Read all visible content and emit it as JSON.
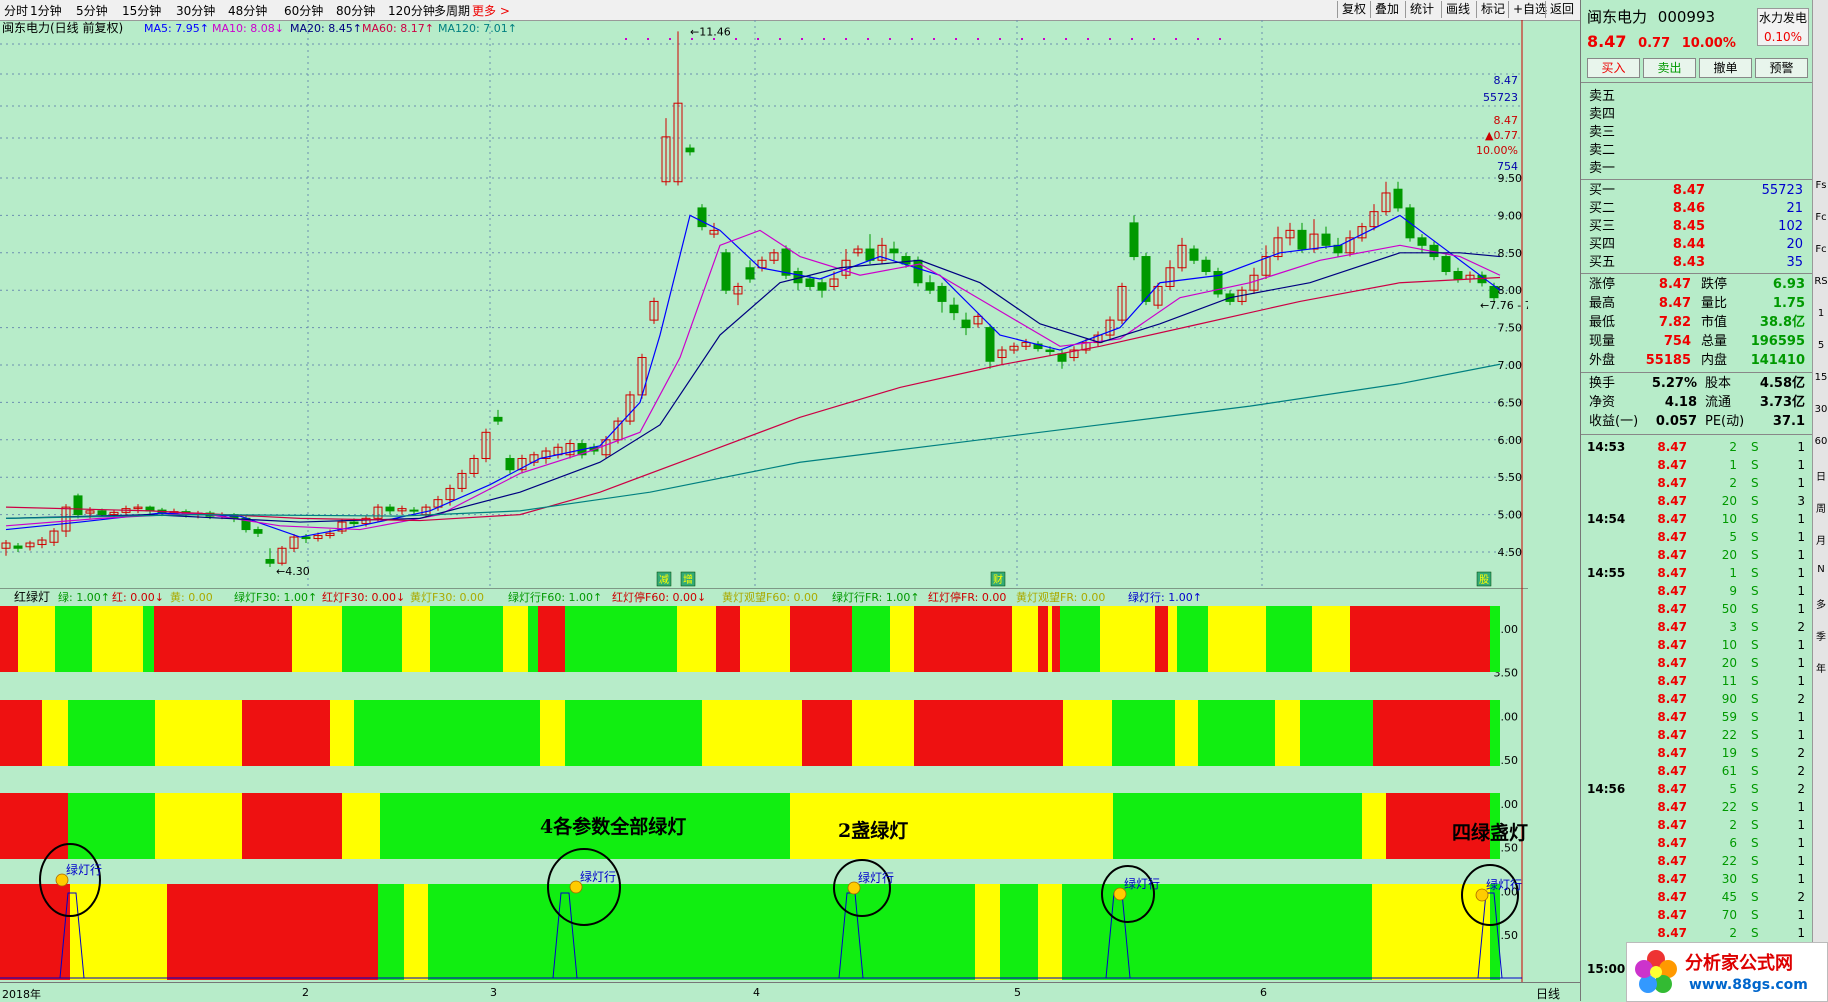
{
  "topbar": {
    "periods": [
      "分时",
      "1分钟",
      "5分钟",
      "15分钟",
      "30分钟",
      "48分钟",
      "60分钟",
      "80分钟",
      "120分钟",
      "多周期",
      "更多 >"
    ],
    "tools": [
      "复权",
      "叠加",
      "统计",
      "画线",
      "标记",
      "+自选",
      "返回"
    ]
  },
  "main": {
    "title": "闽东电力(日线 前复权)",
    "ma_labels": [
      "MA5: 7.95↑",
      "MA10: 8.08↓",
      "MA20: 8.45↑",
      "MA60: 8.17↑",
      "MA120: 7.01↑"
    ],
    "ma_colors": [
      "#0000ff",
      "#cc00cc",
      "#000080",
      "#cc0044",
      "#008080"
    ],
    "high_label": "11.46",
    "low_label": "4.30",
    "range_label": "7.76 - 7.8",
    "price_scale": [
      "9.50",
      "9.00",
      "8.50",
      "8.00",
      "7.50",
      "7.00",
      "6.50",
      "6.00",
      "5.50",
      "5.00",
      "4.50"
    ],
    "side_quote": [
      "8.47",
      "55723",
      "8.47",
      "▲0.77",
      "10.00%",
      "754"
    ],
    "markers": [
      "减",
      "增",
      "财",
      "股"
    ]
  },
  "indicator": {
    "title": "红绿灯",
    "legend": [
      "绿: 1.00↑",
      "红: 0.00↓",
      "黄: 0.00",
      "绿灯F30: 1.00↑",
      "红灯F30: 0.00↓",
      "黄灯F30: 0.00",
      "绿灯行F60: 1.00↑",
      "红灯停F60: 0.00↓",
      "黄灯观望F60: 0.00",
      "绿灯行FR: 1.00↑",
      "红灯停FR: 0.00",
      "黄灯观望FR: 0.00",
      "绿灯行: 1.00↑"
    ],
    "scale": [
      "4.00",
      "3.50",
      "3.00",
      "2.50",
      "2.00",
      "1.50",
      "1.00",
      "0.50"
    ],
    "annotations": [
      "4各参数全部绿灯",
      "2盏绿灯",
      "四绿盏灯"
    ],
    "circle_label": "绿灯行",
    "colors": {
      "red": "#ee1111",
      "yellow": "#ffff00",
      "green": "#11ee11"
    }
  },
  "xaxis": {
    "labels": [
      "2018年",
      "2",
      "3",
      "4",
      "5",
      "6"
    ],
    "period": "日线"
  },
  "stock": {
    "name": "闽东电力",
    "code": "000993",
    "price": "8.47",
    "change": "0.77",
    "pct": "10.00%",
    "sector": "水力发电",
    "sector_pct": "0.10%",
    "buttons": [
      "买入",
      "卖出",
      "撤单",
      "预警"
    ]
  },
  "orderbook": {
    "sells": [
      {
        "label": "卖五",
        "price": "",
        "vol": ""
      },
      {
        "label": "卖四",
        "price": "",
        "vol": ""
      },
      {
        "label": "卖三",
        "price": "",
        "vol": ""
      },
      {
        "label": "卖二",
        "price": "",
        "vol": ""
      },
      {
        "label": "卖一",
        "price": "",
        "vol": ""
      }
    ],
    "buys": [
      {
        "label": "买一",
        "price": "8.47",
        "vol": "55723"
      },
      {
        "label": "买二",
        "price": "8.46",
        "vol": "21"
      },
      {
        "label": "买三",
        "price": "8.45",
        "vol": "102"
      },
      {
        "label": "买四",
        "price": "8.44",
        "vol": "20"
      },
      {
        "label": "买五",
        "price": "8.43",
        "vol": "35"
      }
    ]
  },
  "stats": [
    {
      "l1": "涨停",
      "v1": "8.47",
      "l2": "跌停",
      "v2": "6.93"
    },
    {
      "l1": "最高",
      "v1": "8.47",
      "l2": "量比",
      "v2": "1.75"
    },
    {
      "l1": "最低",
      "v1": "7.82",
      "l2": "市值",
      "v2": "38.8亿"
    },
    {
      "l1": "现量",
      "v1": "754",
      "l2": "总量",
      "v2": "196595"
    },
    {
      "l1": "外盘",
      "v1": "55185",
      "l2": "内盘",
      "v2": "141410"
    }
  ],
  "stats2": [
    {
      "l1": "换手",
      "v1": "5.27%",
      "l2": "股本",
      "v2": "4.58亿"
    },
    {
      "l1": "净资",
      "v1": "4.18",
      "l2": "流通",
      "v2": "3.73亿"
    },
    {
      "l1": "收益(一)",
      "v1": "0.057",
      "l2": "PE(动)",
      "v2": "37.1"
    }
  ],
  "ticks": [
    {
      "t": "14:53",
      "p": "8.47",
      "v": "2",
      "s": "S",
      "n": "1"
    },
    {
      "t": "",
      "p": "8.47",
      "v": "1",
      "s": "S",
      "n": "1"
    },
    {
      "t": "",
      "p": "8.47",
      "v": "2",
      "s": "S",
      "n": "1"
    },
    {
      "t": "",
      "p": "8.47",
      "v": "20",
      "s": "S",
      "n": "3"
    },
    {
      "t": "14:54",
      "p": "8.47",
      "v": "10",
      "s": "S",
      "n": "1"
    },
    {
      "t": "",
      "p": "8.47",
      "v": "5",
      "s": "S",
      "n": "1"
    },
    {
      "t": "",
      "p": "8.47",
      "v": "20",
      "s": "S",
      "n": "1"
    },
    {
      "t": "14:55",
      "p": "8.47",
      "v": "1",
      "s": "S",
      "n": "1"
    },
    {
      "t": "",
      "p": "8.47",
      "v": "9",
      "s": "S",
      "n": "1"
    },
    {
      "t": "",
      "p": "8.47",
      "v": "50",
      "s": "S",
      "n": "1"
    },
    {
      "t": "",
      "p": "8.47",
      "v": "3",
      "s": "S",
      "n": "2"
    },
    {
      "t": "",
      "p": "8.47",
      "v": "10",
      "s": "S",
      "n": "1"
    },
    {
      "t": "",
      "p": "8.47",
      "v": "20",
      "s": "S",
      "n": "1"
    },
    {
      "t": "",
      "p": "8.47",
      "v": "11",
      "s": "S",
      "n": "1"
    },
    {
      "t": "",
      "p": "8.47",
      "v": "90",
      "s": "S",
      "n": "2"
    },
    {
      "t": "",
      "p": "8.47",
      "v": "59",
      "s": "S",
      "n": "1"
    },
    {
      "t": "",
      "p": "8.47",
      "v": "22",
      "s": "S",
      "n": "1"
    },
    {
      "t": "",
      "p": "8.47",
      "v": "19",
      "s": "S",
      "n": "2"
    },
    {
      "t": "",
      "p": "8.47",
      "v": "61",
      "s": "S",
      "n": "2"
    },
    {
      "t": "14:56",
      "p": "8.47",
      "v": "5",
      "s": "S",
      "n": "2"
    },
    {
      "t": "",
      "p": "8.47",
      "v": "22",
      "s": "S",
      "n": "1"
    },
    {
      "t": "",
      "p": "8.47",
      "v": "2",
      "s": "S",
      "n": "1"
    },
    {
      "t": "",
      "p": "8.47",
      "v": "6",
      "s": "S",
      "n": "1"
    },
    {
      "t": "",
      "p": "8.47",
      "v": "22",
      "s": "S",
      "n": "1"
    },
    {
      "t": "",
      "p": "8.47",
      "v": "30",
      "s": "S",
      "n": "1"
    },
    {
      "t": "",
      "p": "8.47",
      "v": "45",
      "s": "S",
      "n": "2"
    },
    {
      "t": "",
      "p": "8.47",
      "v": "70",
      "s": "S",
      "n": "1"
    },
    {
      "t": "",
      "p": "8.47",
      "v": "2",
      "s": "S",
      "n": "1"
    },
    {
      "t": "",
      "p": "8.47",
      "v": "5",
      "s": "S",
      "n": "1"
    },
    {
      "t": "15:00",
      "p": "",
      "v": "",
      "s": "",
      "n": ""
    }
  ],
  "watermark": {
    "line1": "分析家公式网",
    "line2": "www.88gs.com"
  },
  "farstrip": [
    "Fs",
    "Fc",
    "Fc",
    "RS",
    "1",
    "5",
    "15",
    "30",
    "60",
    "日",
    "周",
    "月",
    "N",
    "多",
    "季",
    "年"
  ]
}
